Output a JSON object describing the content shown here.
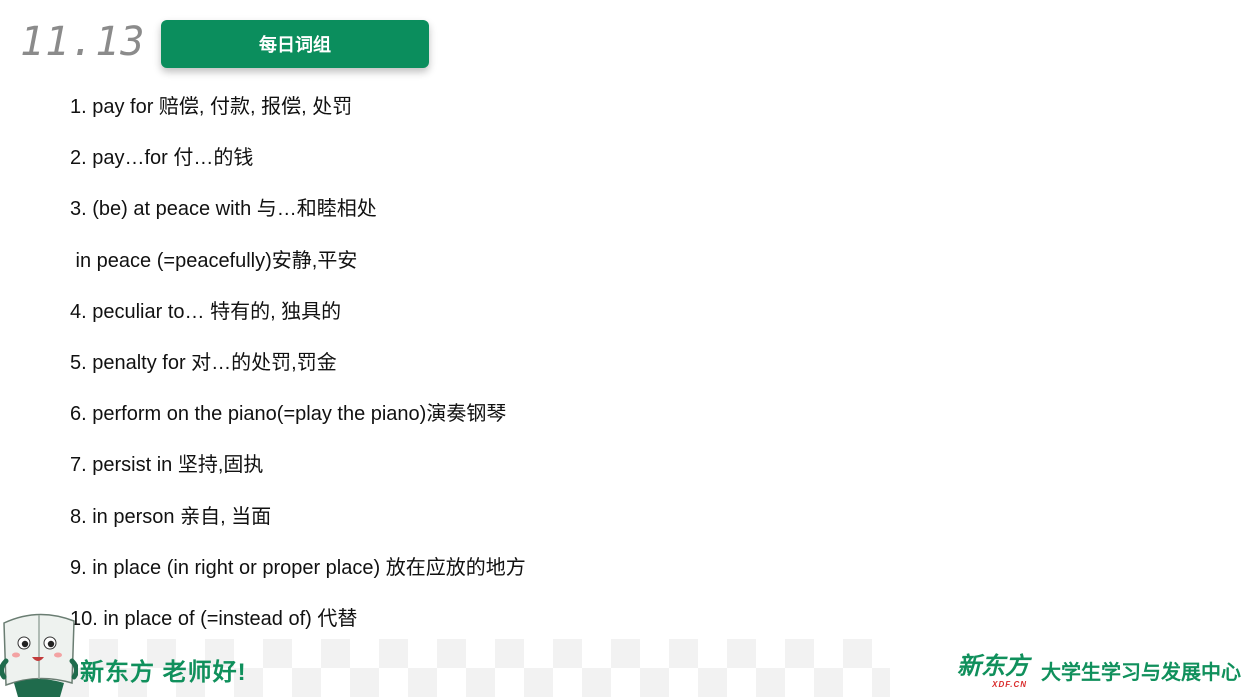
{
  "header": {
    "date": "11.13",
    "title": "每日词组"
  },
  "phrases": [
    "1. pay for 赔偿, 付款, 报偿, 处罚",
    "2. pay…for 付…的钱",
    "3. (be) at peace with 与…和睦相处",
    " in peace (=peacefully)安静,平安",
    "4. peculiar to… 特有的, 独具的",
    "5. penalty for 对…的处罚,罚金",
    "6. perform on the piano(=play the piano)演奏钢琴",
    "7. persist in 坚持,固执",
    "8. in person 亲自, 当面",
    "9. in place (in right or proper place) 放在应放的地方",
    "10. in place of (=instead of) 代替"
  ],
  "footer": {
    "slogan": "新东方 老师好!",
    "brand_logo": "新东方",
    "brand_logo_sub": "XDF.CN",
    "brand_name": "大学生学习与发展中心"
  },
  "colors": {
    "accent": "#0b8e5d",
    "brand_green": "#10905c",
    "date_gray": "#8b8b8b"
  },
  "icons": {
    "mascot": "book-mascot-icon"
  }
}
